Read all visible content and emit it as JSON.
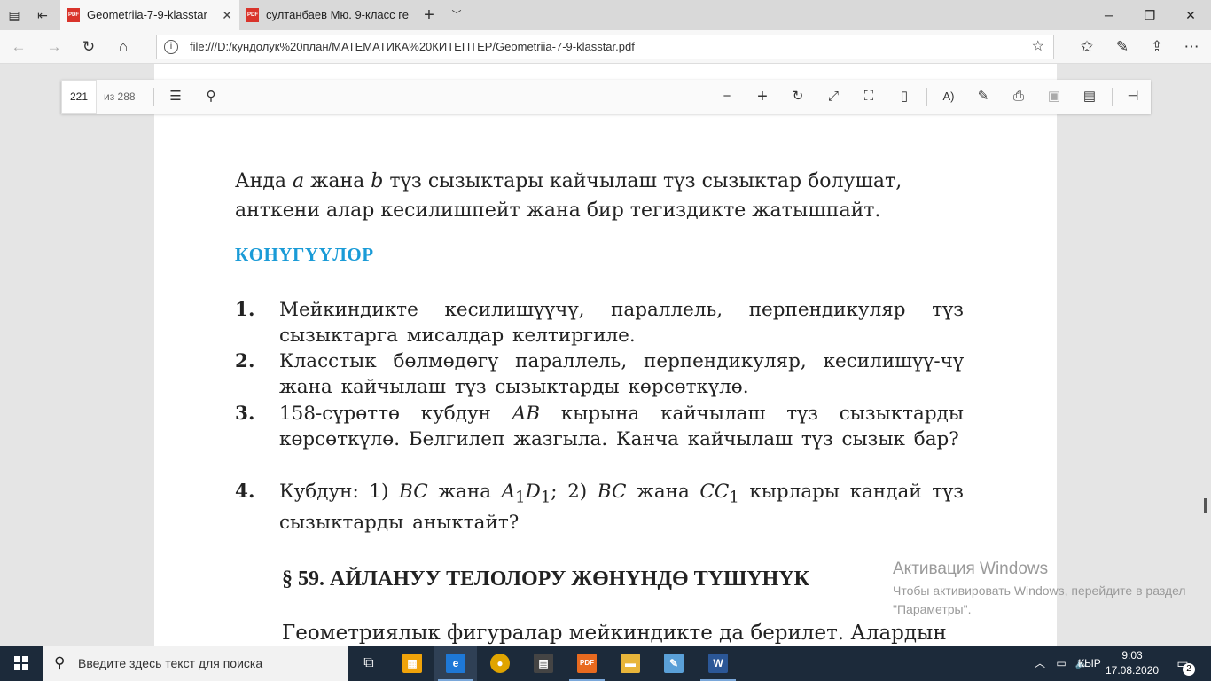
{
  "browser": {
    "tabs": [
      {
        "title": "Geometriia-7-9-klasstar",
        "active": true
      },
      {
        "title": "султанбаев Мю. 9-класс ге",
        "active": false
      }
    ],
    "new_tab_icon": "plus-icon",
    "tab_list_icon": "chevron-down-icon",
    "address": "file:///D:/кундолук%20план/МАТЕМАТИКА%20КИТЕПТЕР/Geometriia-7-9-klasstar.pdf"
  },
  "pdf_toolbar": {
    "current_page": "221",
    "page_count": "из 288"
  },
  "document": {
    "paragraph": {
      "line1_a": "Анда ",
      "line1_var_a": "a",
      "line1_b": " жана ",
      "line1_var_b": "b",
      "line1_c": " түз сызыктары кайчылаш түз сызыктар болушат,",
      "line2": "анткени алар кесилишпейт жана бир тегиздикте жатышпайт."
    },
    "exercises_heading": "КӨНҮГҮҮЛӨР",
    "exercises": [
      {
        "num": "1.",
        "text": "Мейкиндикте кесилишүүчү, параллель, перпендикуляр түз сызыктарга мисалдар келтиргиле."
      },
      {
        "num": "2.",
        "text": "Класстык бөлмөдөгү параллель, перпендикуляр, кесилишүү-чү жана кайчылаш түз сызыктарды көрсөткүлө."
      },
      {
        "num": "3.",
        "text_a": "158-сүрөттө кубдун ",
        "var": "AB",
        "text_b": " кырына кайчылаш түз сызыктарды көрсөткүлө. Белгилеп жазгыла. Канча кайчылаш түз сызык бар?"
      },
      {
        "num": "4.",
        "t1": "Кубдун: 1) ",
        "v1": "BC",
        "t2": " жана ",
        "v2": "A",
        "s2": "1",
        "v3": "D",
        "s3": "1",
        "t3": "; 2) ",
        "v4": "BC",
        "t4": " жана ",
        "v5": "CC",
        "s5": "1",
        "t5": " кырлары кандай түз сызыктарды аныктайт?"
      }
    ],
    "section_title": "§ 59. АЙЛАНУУ ТЕЛОЛОРУ ЖӨНҮНДӨ ТҮШҮНҮК",
    "section_intro": "Геометриялык фигуралар мейкиндикте да берилет. Алардын"
  },
  "activation": {
    "title": "Активация Windows",
    "text": "Чтобы активировать Windows, перейдите в раздел \"Параметры\"."
  },
  "taskbar": {
    "search_placeholder": "Введите здесь текст для поиска",
    "language": "КЫР",
    "time": "9:03",
    "date": "17.08.2020",
    "notifications": "2"
  },
  "colors": {
    "heading_blue": "#1a9bd7",
    "taskbar": "#1c2a3a",
    "pdf_red": "#d9342b"
  }
}
